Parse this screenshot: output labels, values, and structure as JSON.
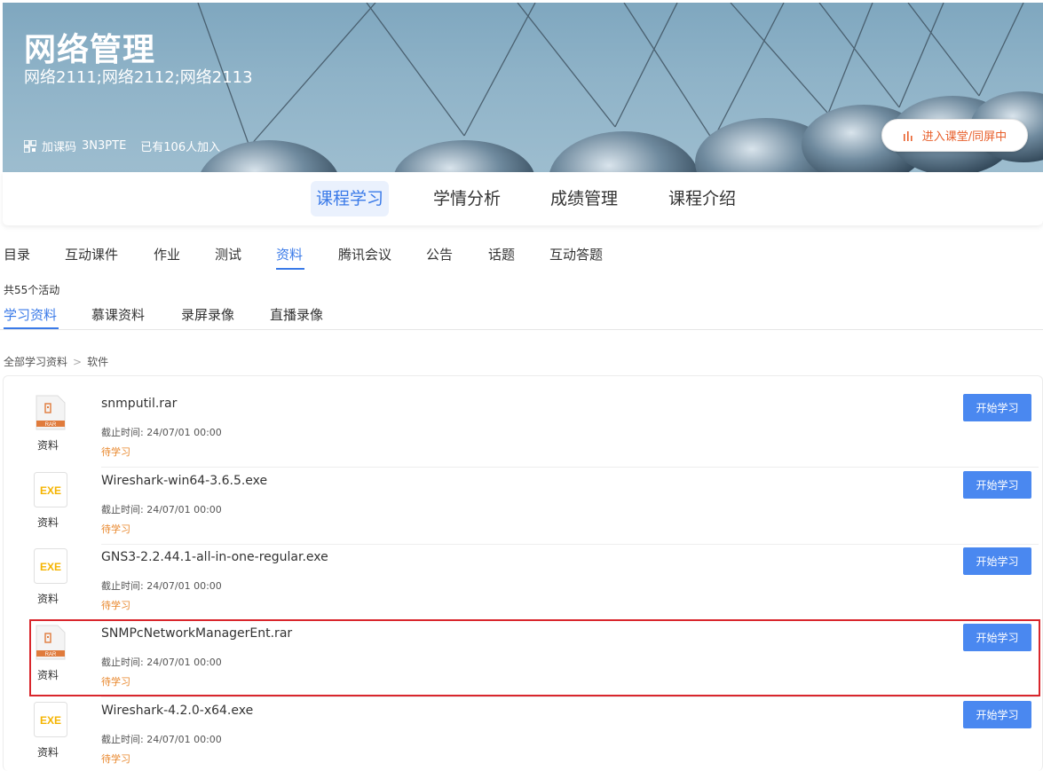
{
  "banner": {
    "title": "网络管理",
    "classes": "网络2111;网络2112;网络2113",
    "join_label": "加课码",
    "join_code": "3N3PTE",
    "joined_text": "已有106人加入",
    "enter_button": "进入课堂/同屏中",
    "accent_color": "#e8602c"
  },
  "main_nav": {
    "tabs": [
      {
        "label": "课程学习",
        "active": true
      },
      {
        "label": "学情分析"
      },
      {
        "label": "成绩管理"
      },
      {
        "label": "课程介绍"
      }
    ]
  },
  "sub_nav": {
    "items": [
      "目录",
      "互动课件",
      "作业",
      "测试",
      "资料",
      "腾讯会议",
      "公告",
      "话题",
      "互动答题"
    ],
    "active": "资料"
  },
  "total_text": "共55个活动",
  "type_tabs": {
    "items": [
      "学习资料",
      "慕课资料",
      "录屏录像",
      "直播录像"
    ],
    "active": "学习资料"
  },
  "breadcrumb": {
    "root": "全部学习资料",
    "sep": ">",
    "current": "软件"
  },
  "files": [
    {
      "name": "snmputil.rar",
      "type": "rar",
      "kind": "资料",
      "deadline": "截止时间: 24/07/01 00:00",
      "status": "待学习",
      "button": "开始学习"
    },
    {
      "name": "Wireshark-win64-3.6.5.exe",
      "type": "exe",
      "kind": "资料",
      "deadline": "截止时间: 24/07/01 00:00",
      "status": "待学习",
      "button": "开始学习"
    },
    {
      "name": "GNS3-2.2.44.1-all-in-one-regular.exe",
      "type": "exe",
      "kind": "资料",
      "deadline": "截止时间: 24/07/01 00:00",
      "status": "待学习",
      "button": "开始学习"
    },
    {
      "name": "SNMPcNetworkManagerEnt.rar",
      "type": "rar",
      "kind": "资料",
      "deadline": "截止时间: 24/07/01 00:00",
      "status": "待学习",
      "button": "开始学习",
      "highlighted": true
    },
    {
      "name": "Wireshark-4.2.0-x64.exe",
      "type": "exe",
      "kind": "资料",
      "deadline": "截止时间: 24/07/01 00:00",
      "status": "待学习",
      "button": "开始学习"
    }
  ],
  "icons": {
    "rar_label": "RAR",
    "exe_label": "EXE",
    "rar_color": "#e07b3c",
    "exe_color": "#f5b400"
  },
  "colors": {
    "primary": "#3a7ae8",
    "button": "#4a88f0",
    "status": "#e8872c",
    "highlight": "#d9262c"
  }
}
